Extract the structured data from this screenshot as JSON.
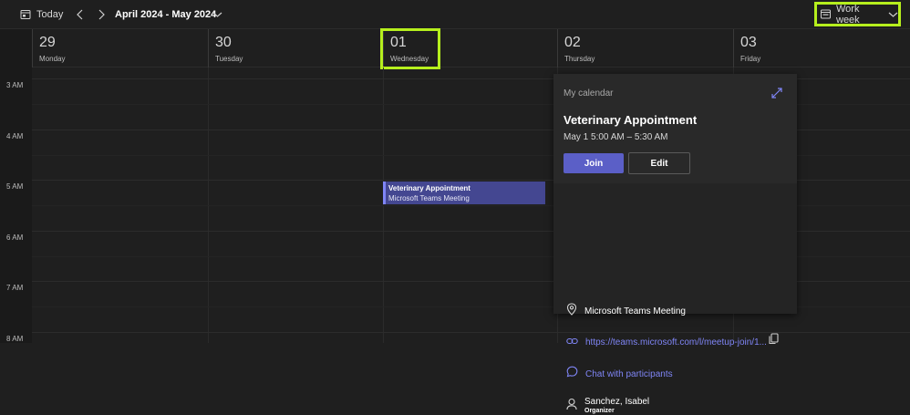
{
  "toolbar": {
    "today_label": "Today",
    "date_range": "April 2024 - May 2024",
    "view_label": "Work week"
  },
  "days": [
    {
      "num": "29",
      "name": "Monday"
    },
    {
      "num": "30",
      "name": "Tuesday"
    },
    {
      "num": "01",
      "name": "Wednesday"
    },
    {
      "num": "02",
      "name": "Thursday"
    },
    {
      "num": "03",
      "name": "Friday"
    }
  ],
  "hours": [
    "3 AM",
    "4 AM",
    "5 AM",
    "6 AM",
    "7 AM",
    "8 AM"
  ],
  "event": {
    "title": "Veterinary Appointment",
    "subtitle": "Microsoft Teams Meeting"
  },
  "popup": {
    "calendar": "My calendar",
    "title": "Veterinary Appointment",
    "time": "May 1 5:00 AM – 5:30 AM",
    "join_label": "Join",
    "edit_label": "Edit",
    "location": "Microsoft Teams Meeting",
    "link": "https://teams.microsoft.com/l/meetup-join/1...",
    "chat_label": "Chat with participants",
    "organizer_name": "Sanchez, Isabel",
    "organizer_role": "Organizer"
  },
  "colors": {
    "accent": "#5b5fc7",
    "highlight": "#b6ef1d",
    "event_bg": "#444791"
  }
}
